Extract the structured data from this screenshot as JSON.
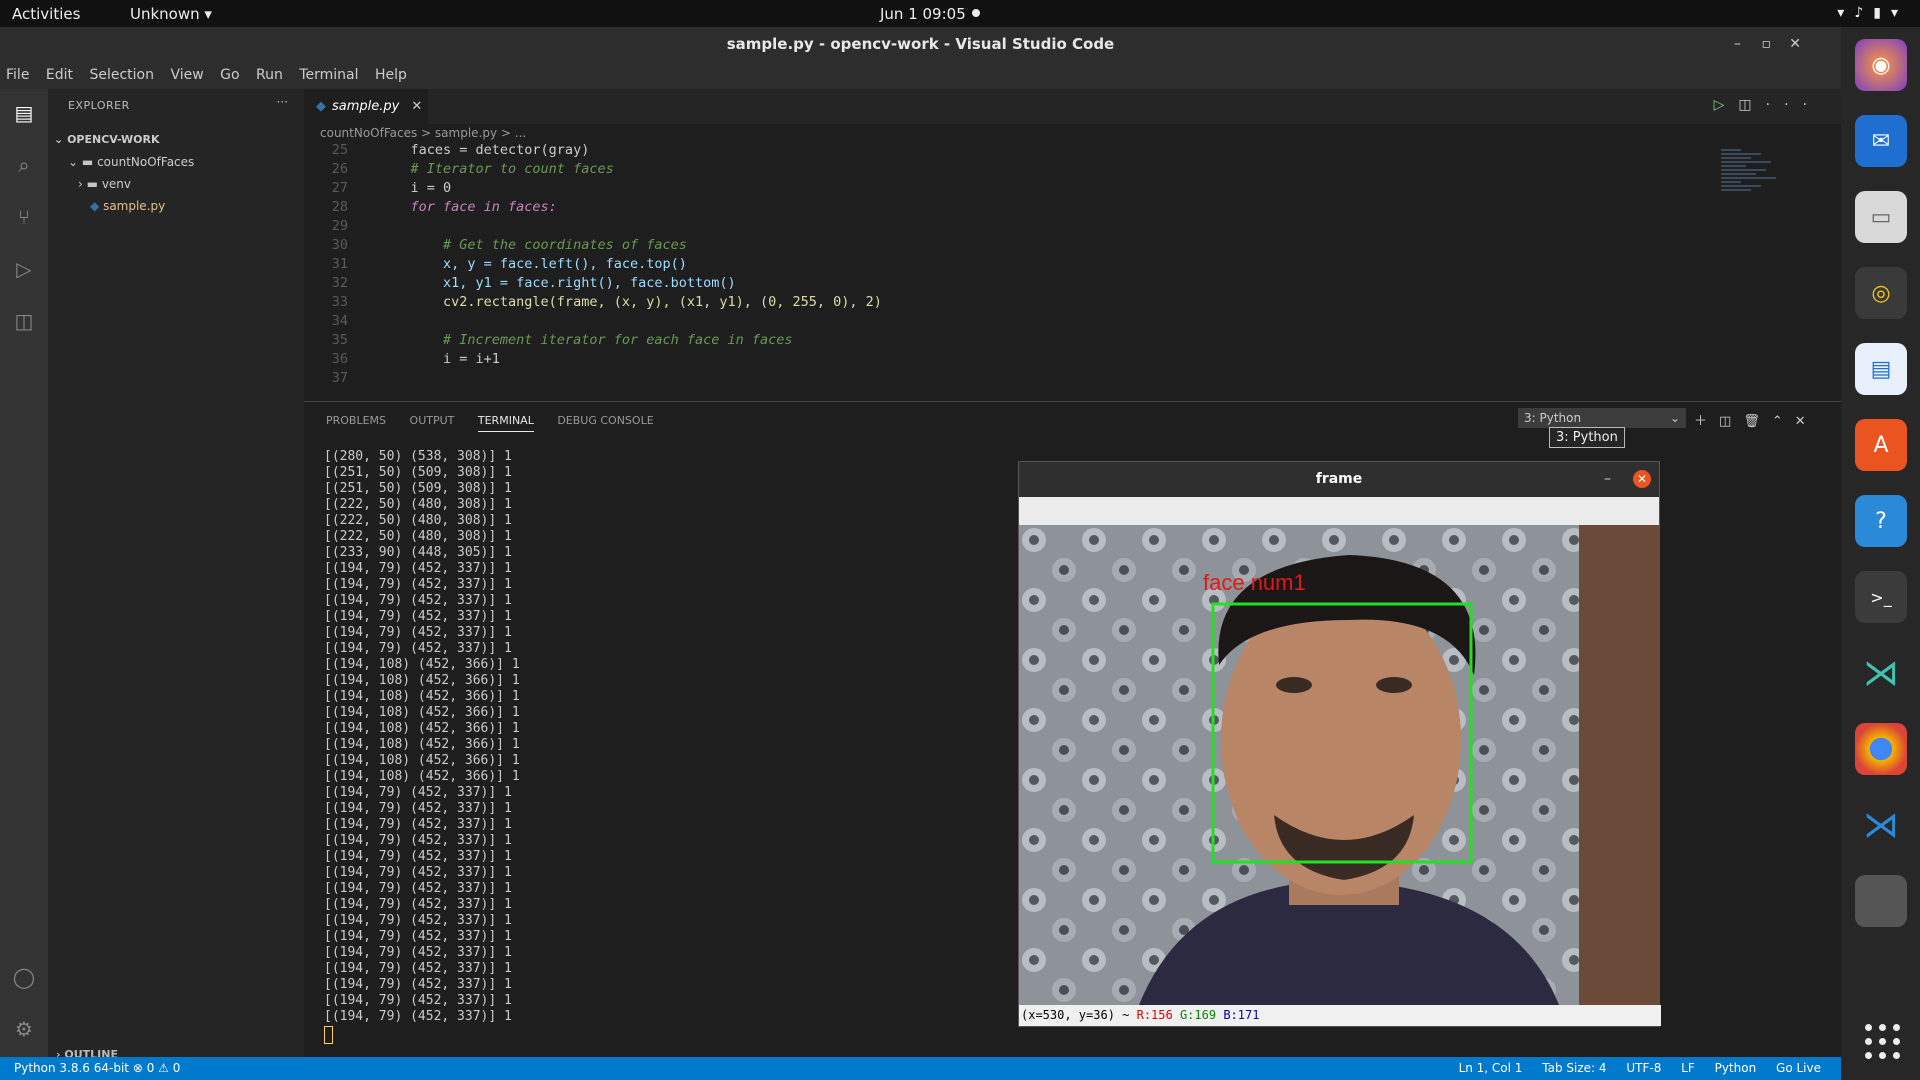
{
  "topbar": {
    "activities": "Activities",
    "app_menu": "Unknown",
    "clock": "Jun 1  09:05"
  },
  "window": {
    "title": "sample.py - opencv-work - Visual Studio Code"
  },
  "menu": [
    "File",
    "Edit",
    "Selection",
    "View",
    "Go",
    "Run",
    "Terminal",
    "Help"
  ],
  "sidebar": {
    "header": "EXPLORER",
    "root": "OPENCV-WORK",
    "folder": "countNoOfFaces",
    "subfolder": "venv",
    "file": "sample.py",
    "outline": "OUTLINE"
  },
  "editor": {
    "tab_label": "sample.py",
    "breadcrumb": "countNoOfFaces  >  sample.py  >  ...",
    "lines": [
      {
        "n": "25",
        "text": "    faces = detector(gray)",
        "cls": ""
      },
      {
        "n": "26",
        "text": "    # Iterator to count faces",
        "cls": "cm"
      },
      {
        "n": "27",
        "text": "    i = 0",
        "cls": ""
      },
      {
        "n": "28",
        "text": "    for face in faces:",
        "cls": "kw"
      },
      {
        "n": "29",
        "text": "",
        "cls": ""
      },
      {
        "n": "30",
        "text": "        # Get the coordinates of faces",
        "cls": "cm"
      },
      {
        "n": "31",
        "text": "        x, y = face.left(), face.top()",
        "cls": "var"
      },
      {
        "n": "32",
        "text": "        x1, y1 = face.right(), face.bottom()",
        "cls": "var"
      },
      {
        "n": "33",
        "text": "        cv2.rectangle(frame, (x, y), (x1, y1), (0, 255, 0), 2)",
        "cls": "fn"
      },
      {
        "n": "34",
        "text": "",
        "cls": ""
      },
      {
        "n": "35",
        "text": "        # Increment iterator for each face in faces",
        "cls": "cm"
      },
      {
        "n": "36",
        "text": "        i = i+1",
        "cls": ""
      },
      {
        "n": "37",
        "text": "",
        "cls": ""
      }
    ]
  },
  "panel": {
    "tabs": [
      "PROBLEMS",
      "OUTPUT",
      "TERMINAL",
      "DEBUG CONSOLE"
    ],
    "active_tab": "TERMINAL",
    "terminal_select": "3: Python",
    "tooltip": "3: Python",
    "terminal_lines": [
      "[(280, 50) (538, 308)] 1",
      "[(251, 50) (509, 308)] 1",
      "[(251, 50) (509, 308)] 1",
      "[(222, 50) (480, 308)] 1",
      "[(222, 50) (480, 308)] 1",
      "[(222, 50) (480, 308)] 1",
      "[(233, 90) (448, 305)] 1",
      "[(194, 79) (452, 337)] 1",
      "[(194, 79) (452, 337)] 1",
      "[(194, 79) (452, 337)] 1",
      "[(194, 79) (452, 337)] 1",
      "[(194, 79) (452, 337)] 1",
      "[(194, 79) (452, 337)] 1",
      "[(194, 108) (452, 366)] 1",
      "[(194, 108) (452, 366)] 1",
      "[(194, 108) (452, 366)] 1",
      "[(194, 108) (452, 366)] 1",
      "[(194, 108) (452, 366)] 1",
      "[(194, 108) (452, 366)] 1",
      "[(194, 108) (452, 366)] 1",
      "[(194, 108) (452, 366)] 1",
      "[(194, 79) (452, 337)] 1",
      "[(194, 79) (452, 337)] 1",
      "[(194, 79) (452, 337)] 1",
      "[(194, 79) (452, 337)] 1",
      "[(194, 79) (452, 337)] 1",
      "[(194, 79) (452, 337)] 1",
      "[(194, 79) (452, 337)] 1",
      "[(194, 79) (452, 337)] 1",
      "[(194, 79) (452, 337)] 1",
      "[(194, 79) (452, 337)] 1",
      "[(194, 79) (452, 337)] 1",
      "[(194, 79) (452, 337)] 1",
      "[(194, 79) (452, 337)] 1",
      "[(194, 79) (452, 337)] 1",
      "[(194, 79) (452, 337)] 1"
    ]
  },
  "frame_window": {
    "title": "frame",
    "label": "face num1",
    "status_coords": "(x=530, y=36) ~ ",
    "status_r": "R:156",
    "status_g": "G:169",
    "status_b": "B:171"
  },
  "statusbar": {
    "left": "Python 3.8.6 64-bit   ⊗ 0 ⚠ 0",
    "right": [
      "Ln 1, Col 1",
      "Tab Size: 4",
      "UTF-8",
      "LF",
      "Python",
      "Go Live"
    ]
  }
}
